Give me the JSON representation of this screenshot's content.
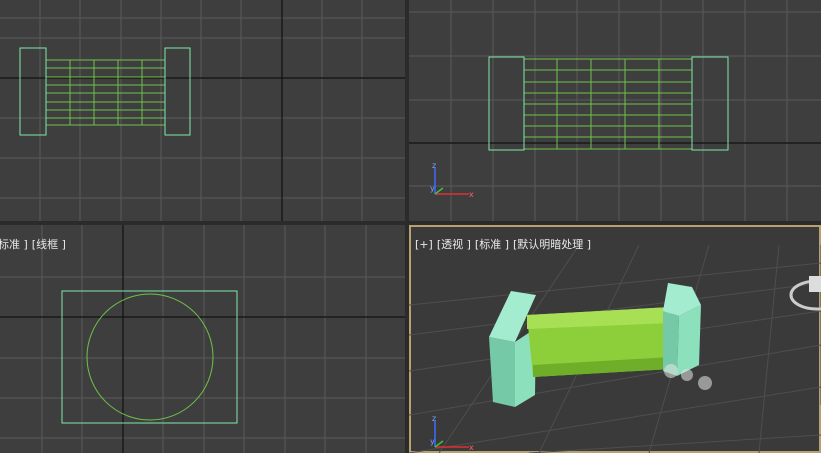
{
  "viewports": {
    "top": {
      "labels": []
    },
    "front": {
      "labels": []
    },
    "left": {
      "labels": [
        "标准 ]",
        "[线框 ]"
      ]
    },
    "perspective": {
      "labels": [
        "[+]",
        "[透视 ]",
        "[标准 ]",
        "[默认明暗处理 ]"
      ]
    }
  },
  "colors": {
    "viewport_bg": "#3e3e3e",
    "grid": "#595959",
    "axis_line": "#111111",
    "wire_green": "#6fc34a",
    "box_outline": "#7ee8a8",
    "active_border": "#b8a070",
    "cylinder": "#8ccf3a",
    "box_fill": "#8de0bc"
  },
  "axis_tripod": {
    "x": "x",
    "y": "y",
    "z": "z"
  }
}
